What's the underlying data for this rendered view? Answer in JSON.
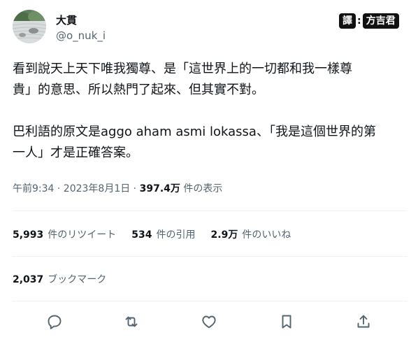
{
  "author": {
    "display_name": "大貫",
    "handle": "@o_nuk_i",
    "avatar_icon": "zen-garden-avatar"
  },
  "watermark": {
    "label": "譯",
    "separator": ":",
    "name": "方吉君"
  },
  "tweet": {
    "paragraph_1": "看到說天上天下唯我獨尊、是「這世界上的一切都和我一樣尊\n貴」的意思、所以熱門了起來、但其實不對。",
    "paragraph_2": "巴利語的原文是aggo aham asmi lokassa、「我是這個世界的第\n一人」才是正確答案。"
  },
  "meta": {
    "timestamp": "午前9:34 · 2023年8月1日 · ",
    "views_count": "397.4万",
    "views_label": " 件の表示"
  },
  "stats": {
    "retweets": {
      "count": "5,993",
      "label": "件のリツイート"
    },
    "quotes": {
      "count": "534",
      "label": "件の引用"
    },
    "likes": {
      "count": "2.9万",
      "label": "件のいいね"
    }
  },
  "bookmarks": {
    "count": "2,037",
    "label": "ブックマーク"
  },
  "actions": [
    {
      "name": "reply",
      "icon": "reply-icon"
    },
    {
      "name": "retweet",
      "icon": "retweet-icon"
    },
    {
      "name": "like",
      "icon": "heart-icon"
    },
    {
      "name": "bookmark",
      "icon": "bookmark-icon"
    },
    {
      "name": "share",
      "icon": "share-icon"
    }
  ],
  "colors": {
    "text_primary": "#0f1419",
    "text_secondary": "#536471",
    "divider": "#eff3f4",
    "watermark_bg": "#111111"
  }
}
